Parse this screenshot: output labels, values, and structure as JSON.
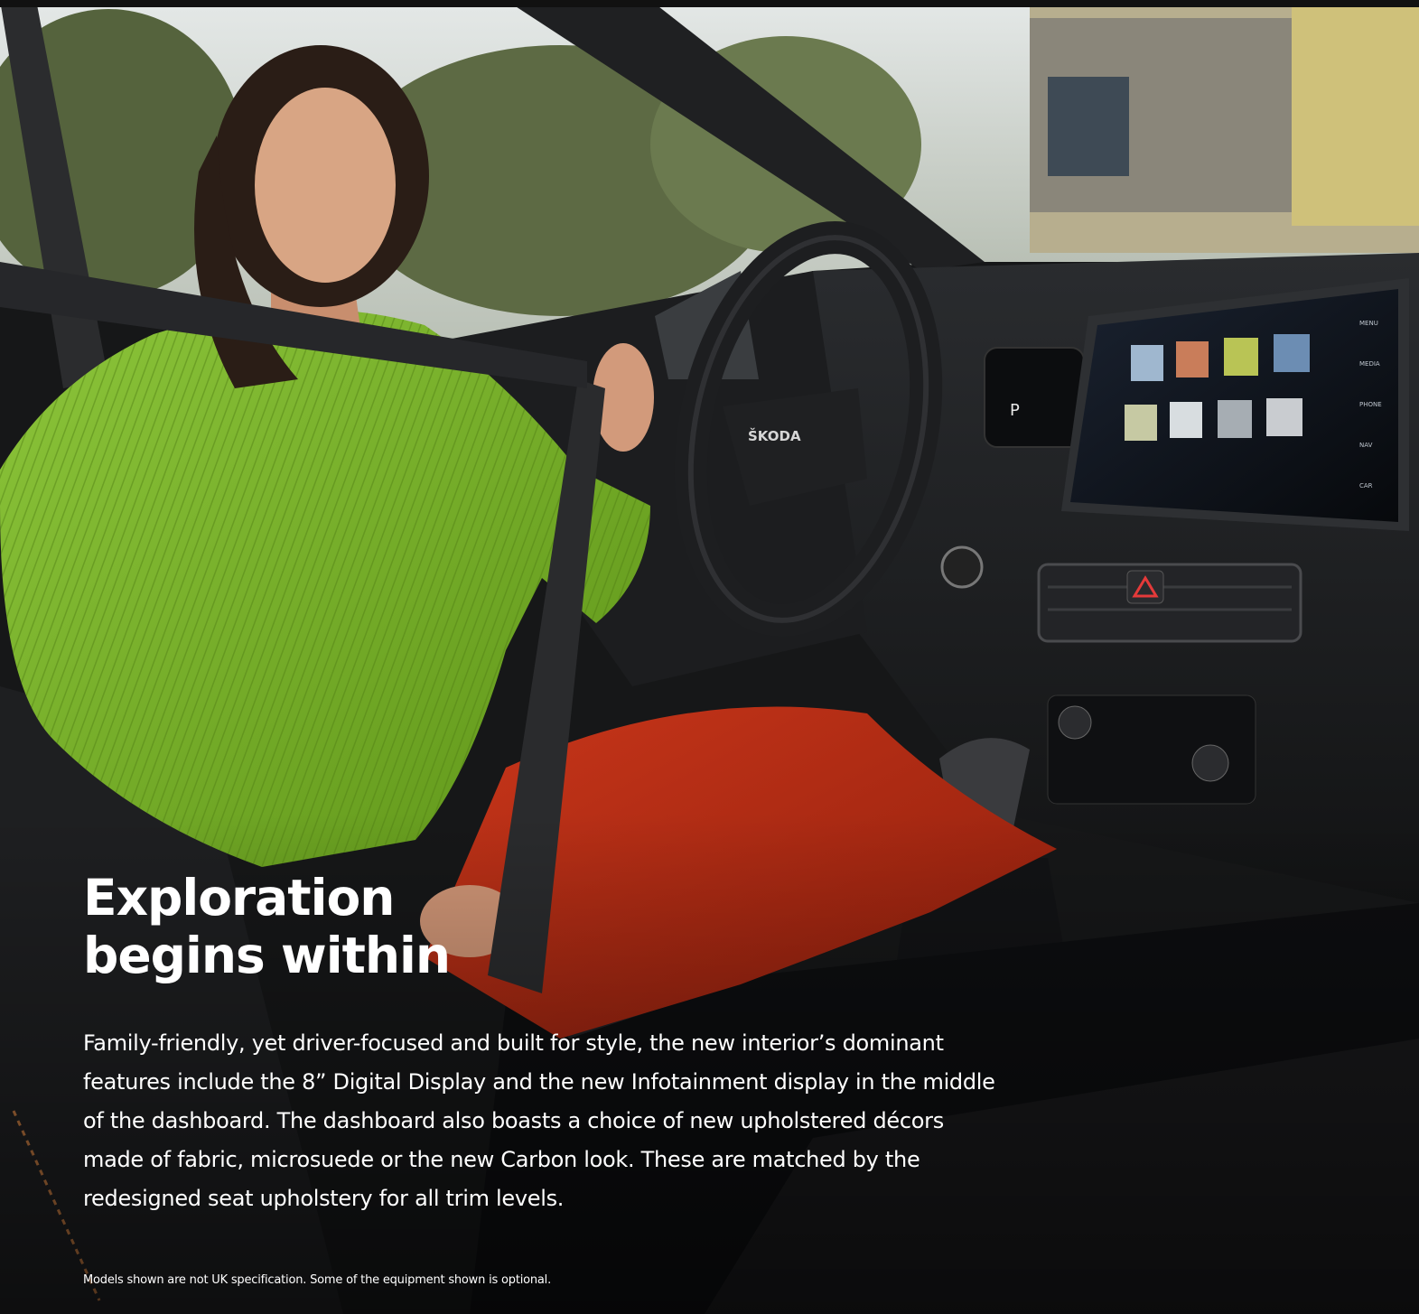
{
  "headline": {
    "line1": "Exploration",
    "line2": "begins within"
  },
  "body": {
    "text": "Family-friendly, yet driver-focused and built for style, the new interior’s dominant features include the 8” Digital Display and the new Infotainment display in the middle of the dashboard. The dashboard also boasts a choice of new upholstered décors made of fabric, microsuede or the new Carbon look. These are matched by the redesigned seat upholstery for all trim levels."
  },
  "disclaimer": {
    "text": "Models shown are not UK specification. Some of the equipment shown is optional."
  },
  "photo": {
    "steering_wheel_badge": "ŠKODA",
    "gear_indicator": "P",
    "screen_menu": [
      "MENU",
      "MEDIA",
      "PHONE",
      "NAV",
      "CAR"
    ],
    "colors": {
      "sweater": "#7cb52a",
      "trousers": "#b52a12",
      "interior": "#1b1c1e",
      "sky": "#d9dedf",
      "foliage": "#5f6d45"
    }
  }
}
